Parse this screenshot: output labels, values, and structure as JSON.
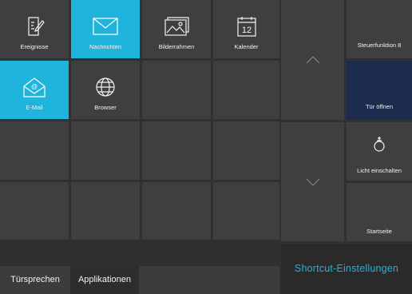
{
  "apps": [
    {
      "label": "Ereignisse",
      "icon": "edit-note-icon",
      "active": false
    },
    {
      "label": "Nachrichten",
      "icon": "envelope-icon",
      "active": true
    },
    {
      "label": "Bilderrahmen",
      "icon": "picture-frame-icon",
      "active": false
    },
    {
      "label": "Kalender",
      "icon": "calendar-icon",
      "active": false,
      "icon_text": "12"
    },
    {
      "label": "E-Mail",
      "icon": "email-at-icon",
      "active": true
    },
    {
      "label": "Browser",
      "icon": "globe-icon",
      "active": false
    }
  ],
  "side": {
    "scroll_up": "chevron-up-icon",
    "scroll_down": "chevron-down-icon",
    "buttons": [
      {
        "label": "Steuerfunktion 8"
      },
      {
        "label": "Tür öffnen"
      },
      {
        "label": "Licht einschalten",
        "icon": "lightbulb-icon"
      },
      {
        "label": "Startseite"
      }
    ]
  },
  "tabs": [
    {
      "label": "Türsprechen",
      "selected": false
    },
    {
      "label": "Applikationen",
      "selected": true
    }
  ],
  "shortcut": {
    "label": "Shortcut-Einstellungen"
  },
  "colors": {
    "accent": "#1eb4dc",
    "tile": "#3f3f3f",
    "door": "#1c2b4e",
    "background": "#313131"
  }
}
